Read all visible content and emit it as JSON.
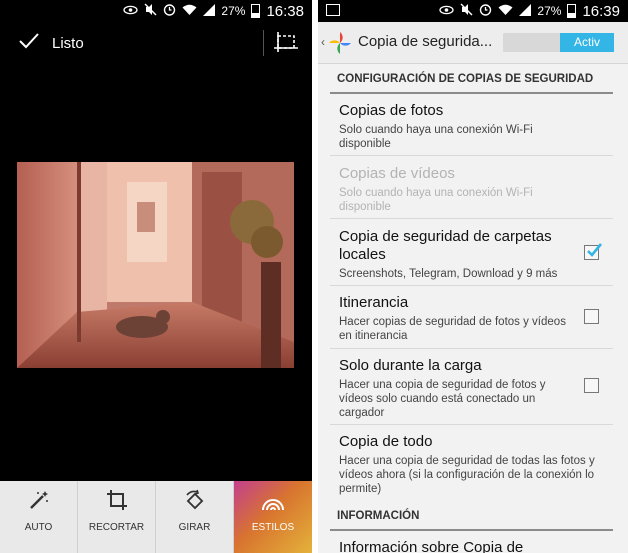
{
  "status_left": {
    "clock": "16:38",
    "battery": "27%"
  },
  "status_right": {
    "clock": "16:39",
    "battery": "27%"
  },
  "editor": {
    "done_label": "Listo",
    "tools": [
      {
        "label": "AUTO",
        "icon": "magic-wand-icon"
      },
      {
        "label": "RECORTAR",
        "icon": "crop-icon"
      },
      {
        "label": "GIRAR",
        "icon": "rotate-icon"
      },
      {
        "label": "ESTILOS",
        "icon": "styles-icon",
        "active": true
      }
    ]
  },
  "settings": {
    "title": "Copia de segurida...",
    "toggle_label": "Activ",
    "section_header": "CONFIGURACIÓN DE COPIAS DE SEGURIDAD",
    "items": [
      {
        "title": "Copias de fotos",
        "subtitle": "Solo cuando haya una conexión Wi-Fi disponible"
      },
      {
        "title": "Copias de vídeos",
        "subtitle": "Solo cuando haya una conexión Wi-Fi disponible",
        "disabled": true
      },
      {
        "title": "Copia de seguridad de carpetas locales",
        "subtitle": "Screenshots, Telegram, Download y 9 más",
        "checked": true
      },
      {
        "title": "Itinerancia",
        "subtitle": "Hacer copias de seguridad de fotos y vídeos en itinerancia",
        "checked": false
      },
      {
        "title": "Solo durante la carga",
        "subtitle": "Hacer una copia de seguridad de fotos y vídeos solo cuando está conectado un cargador",
        "checked": false
      },
      {
        "title": "Copia de todo",
        "subtitle": "Hacer una copia de seguridad de todas las fotos y vídeos ahora (si la configuración de la conexión lo permite)"
      }
    ],
    "info_header": "INFORMACIÓN",
    "info_item": "Información sobre Copia de"
  }
}
